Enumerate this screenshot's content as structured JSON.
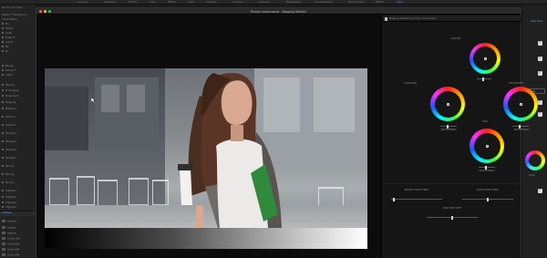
{
  "workspace": {
    "tabs": [
      "Learning",
      "Assembly",
      "Editing",
      "Color",
      "Effects",
      "Audio",
      "Graphics",
      "Libraries",
      "All Panels",
      "Metalogging",
      "Roundtripping",
      "Editing (CS6)",
      "Effects",
      "Color"
    ]
  },
  "plugin": {
    "window_title": "Picture Instruments - Mapping Wheels",
    "panel_title": "Mapping Wheels by Picture Instruments"
  },
  "wheels": {
    "master": {
      "label": "MASTER"
    },
    "shadows": {
      "label": "SHADOWS",
      "slider_label": "SMOOTHNESS"
    },
    "highlights": {
      "label": "HIGHLIGHTS",
      "slider_label": "SMOOTHNESS"
    },
    "skin": {
      "label": "SKIN",
      "slider_label": "SMOOTHNESS"
    }
  },
  "skin_controls": {
    "protect": "PROTECT SKIN TONES",
    "adjust": "ADJUST SKIN TONES",
    "shift": "SKIN TONE SHIFT"
  },
  "left_panel": {
    "title": "Source: (no clips)",
    "effects": [
      "Master * Hintergrund",
      "Video Effects",
      "Mo",
      "Positio",
      "Scale",
      "Scale W",
      "Anti-Fl",
      "Ba",
      "Ro",
      "Backgr",
      "Ancher P",
      "Anti-Fl",
      "Opacity",
      "Time Rema",
      "Mapping W",
      "Mapping",
      "Master G",
      "Globe G",
      "Global H",
      "Shadows",
      "Shadows",
      "Shadows",
      "Shadows",
      "Mid Lig",
      "Mid Lig",
      "Mid Lig",
      "Highlight",
      "Highlight",
      "Highlight",
      "Highlight",
      "Highlight"
    ],
    "bin_label": "Untitled",
    "bin_items": [
      "Untitled",
      "Images",
      "Happen",
      "Screen Rec",
      "Audio Effe",
      "Audio Effe",
      "Audio Effe"
    ]
  },
  "right_host": {
    "label_top": "Auto Tone",
    "button_label": "Reset",
    "label_bottom": "Temp"
  },
  "colors": {
    "accent_blue": "#5aa0ff",
    "traffic_red": "#ff5f57",
    "traffic_yellow": "#febc2e",
    "traffic_green": "#28c840"
  }
}
